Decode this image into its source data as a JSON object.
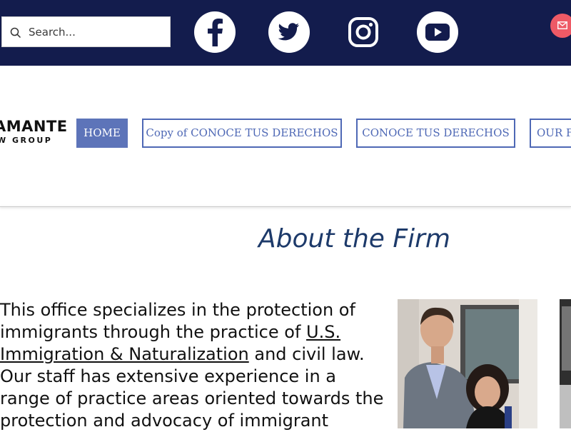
{
  "search": {
    "placeholder": "Search..."
  },
  "social": [
    {
      "name": "facebook-icon"
    },
    {
      "name": "twitter-icon"
    },
    {
      "name": "instagram-icon"
    },
    {
      "name": "youtube-icon"
    }
  ],
  "logo": {
    "main": "AMANTE",
    "sub": "W GROUP"
  },
  "nav": {
    "items": [
      {
        "label": "HOME"
      },
      {
        "label": "Copy of CONOCE TUS DERECHOS"
      },
      {
        "label": "CONOCE TUS DERECHOS"
      },
      {
        "label": "OUR F"
      }
    ]
  },
  "main": {
    "title": "About the Firm",
    "body": {
      "p1": "This office specializes in the protection of immigrants through the practice of ",
      "link": "U.S. Immigration & Naturalization",
      "p2": " and civil law. Our staff has extensive experience in a range of practice areas oriented towards the protection and advocacy of immigrant"
    }
  },
  "colors": {
    "topbar": "#131c4d",
    "nav_accent": "#4e68b5",
    "title": "#1d3a6a",
    "mail": "#ee5a66"
  }
}
